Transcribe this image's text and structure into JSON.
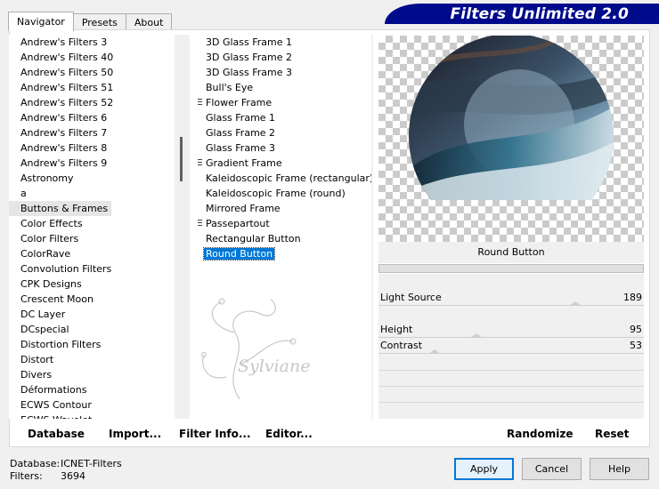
{
  "tabs": [
    {
      "label": "Navigator",
      "active": true
    },
    {
      "label": "Presets",
      "active": false
    },
    {
      "label": "About",
      "active": false
    }
  ],
  "banner": {
    "title": "Filters Unlimited 2.0"
  },
  "categories": {
    "items": [
      "Andrew's Filters 3",
      "Andrew's Filters 40",
      "Andrew's Filters 50",
      "Andrew's Filters 51",
      "Andrew's Filters 52",
      "Andrew's Filters 6",
      "Andrew's Filters 7",
      "Andrew's Filters 8",
      "Andrew's Filters 9",
      "Astronomy",
      "a",
      "Buttons & Frames",
      "Color Effects",
      "Color Filters",
      "ColorRave",
      "Convolution Filters",
      "CPK Designs",
      "Crescent Moon",
      "DC Layer",
      "DCspecial",
      "Distortion Filters",
      "Distort",
      "Divers",
      "Déformations",
      "ECWS Contour",
      "ECWS Wavelet"
    ],
    "selected": "Buttons & Frames"
  },
  "filters": {
    "items": [
      {
        "label": "3D Glass Frame 1",
        "grip": false
      },
      {
        "label": "3D Glass Frame 2",
        "grip": false
      },
      {
        "label": "3D Glass Frame 3",
        "grip": false
      },
      {
        "label": "Bull's Eye",
        "grip": false
      },
      {
        "label": "Flower Frame",
        "grip": true
      },
      {
        "label": "Glass Frame 1",
        "grip": false
      },
      {
        "label": "Glass Frame 2",
        "grip": false
      },
      {
        "label": "Glass Frame 3",
        "grip": false
      },
      {
        "label": "Gradient Frame",
        "grip": true
      },
      {
        "label": "Kaleidoscopic Frame (rectangular)",
        "grip": false
      },
      {
        "label": "Kaleidoscopic Frame (round)",
        "grip": false
      },
      {
        "label": "Mirrored Frame",
        "grip": false
      },
      {
        "label": "Passepartout",
        "grip": true
      },
      {
        "label": "Rectangular Button",
        "grip": false
      },
      {
        "label": "Round Button",
        "grip": false
      }
    ],
    "selected": "Round Button"
  },
  "watermark": {
    "text": "Sylviane"
  },
  "preview": {
    "filter_name": "Round Button"
  },
  "params": [
    {
      "label": "Light Source",
      "value": "189",
      "fraction": 0.74
    },
    {
      "label": "Height",
      "value": "95",
      "fraction": 0.37
    },
    {
      "label": "Contrast",
      "value": "53",
      "fraction": 0.21
    }
  ],
  "toolbar": {
    "database": "Database",
    "import": "Import...",
    "filter_info": "Filter Info...",
    "editor": "Editor...",
    "randomize": "Randomize",
    "reset": "Reset"
  },
  "status": {
    "database_label": "Database:",
    "database_value": "ICNET-Filters",
    "filters_label": "Filters:",
    "filters_value": "3694"
  },
  "buttons": {
    "apply": "Apply",
    "cancel": "Cancel",
    "help": "Help"
  }
}
